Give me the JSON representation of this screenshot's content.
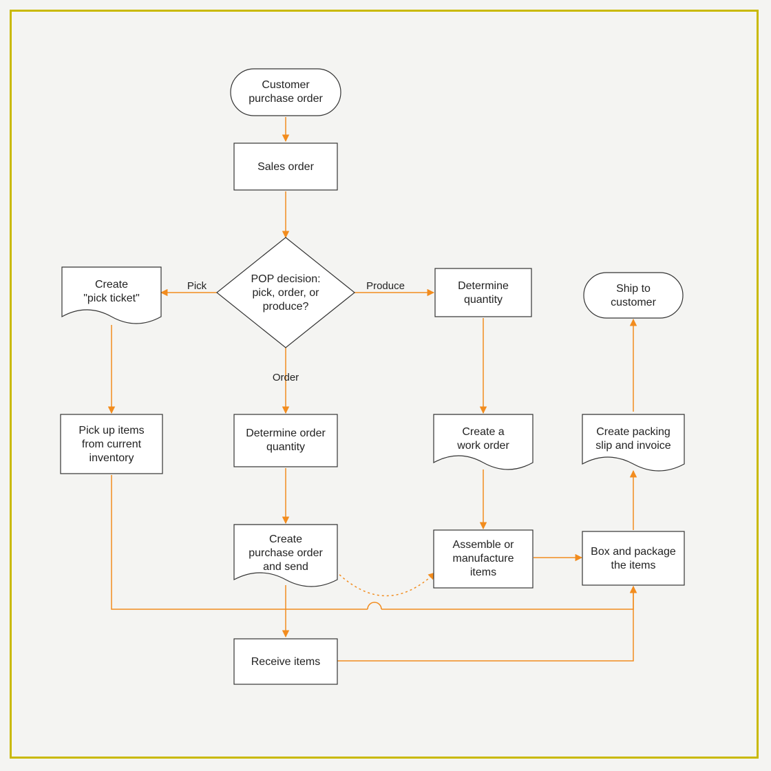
{
  "colors": {
    "border": "#c9b900",
    "connector": "#f28c1e",
    "shapeStroke": "#333333",
    "shapeFill": "#ffffff",
    "background": "#f4f4f2"
  },
  "nodes": {
    "start": {
      "type": "terminator",
      "line1": "Customer",
      "line2": "purchase order"
    },
    "sales": {
      "type": "process",
      "line1": "Sales order"
    },
    "decision": {
      "type": "decision",
      "line1": "POP decision:",
      "line2": "pick, order, or",
      "line3": "produce?"
    },
    "pickTicket": {
      "type": "document",
      "line1": "Create",
      "line2": "\"pick ticket\""
    },
    "detQty": {
      "type": "process",
      "line1": "Determine",
      "line2": "quantity"
    },
    "ship": {
      "type": "terminator",
      "line1": "Ship to",
      "line2": "customer"
    },
    "pickup": {
      "type": "process",
      "line1": "Pick up items",
      "line2": "from current",
      "line3": "inventory"
    },
    "detOrderQty": {
      "type": "process",
      "line1": "Determine order",
      "line2": "quantity"
    },
    "workOrder": {
      "type": "document",
      "line1": "Create a",
      "line2": "work order"
    },
    "packing": {
      "type": "document",
      "line1": "Create packing",
      "line2": "slip and invoice"
    },
    "createPO": {
      "type": "document",
      "line1": "Create",
      "line2": "purchase order",
      "line3": "and send"
    },
    "assemble": {
      "type": "process",
      "line1": "Assemble or",
      "line2": "manufacture",
      "line3": "items"
    },
    "box": {
      "type": "process",
      "line1": "Box and package",
      "line2": "the items"
    },
    "receive": {
      "type": "process",
      "line1": "Receive items"
    }
  },
  "edges": {
    "pick": "Pick",
    "produce": "Produce",
    "order": "Order"
  }
}
